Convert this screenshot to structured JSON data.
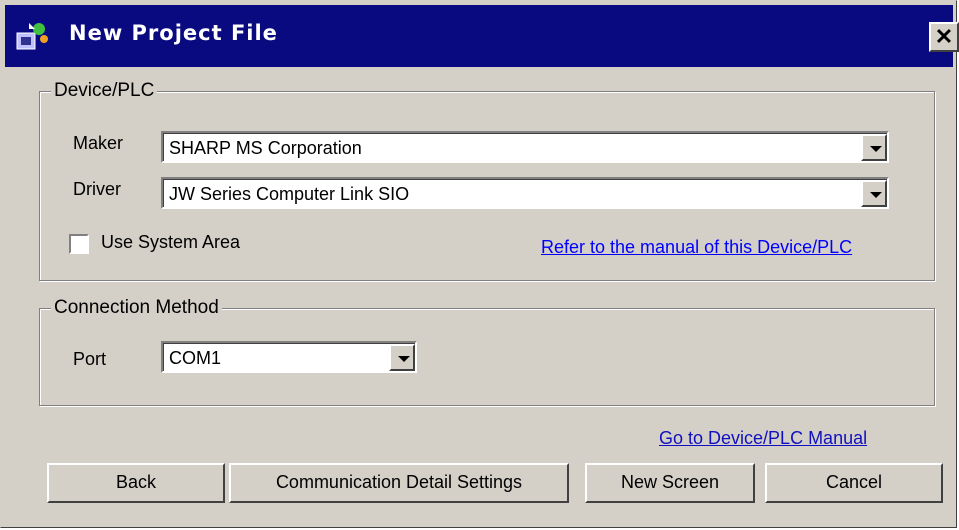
{
  "window": {
    "title": "New Project File",
    "close_label": "✕"
  },
  "device_group": {
    "title": "Device/PLC",
    "maker_label": "Maker",
    "maker_value": "SHARP MS Corporation",
    "driver_label": "Driver",
    "driver_value": "JW Series Computer Link SIO",
    "use_system_area_label": "Use System Area",
    "use_system_area_checked": false,
    "manual_link": "Refer to the manual of this Device/PLC"
  },
  "connection_group": {
    "title": "Connection Method",
    "port_label": "Port",
    "port_value": "COM1"
  },
  "manual_link2": "Go to Device/PLC Manual",
  "buttons": {
    "back": "Back",
    "comm": "Communication Detail Settings",
    "new_screen": "New Screen",
    "cancel": "Cancel"
  }
}
